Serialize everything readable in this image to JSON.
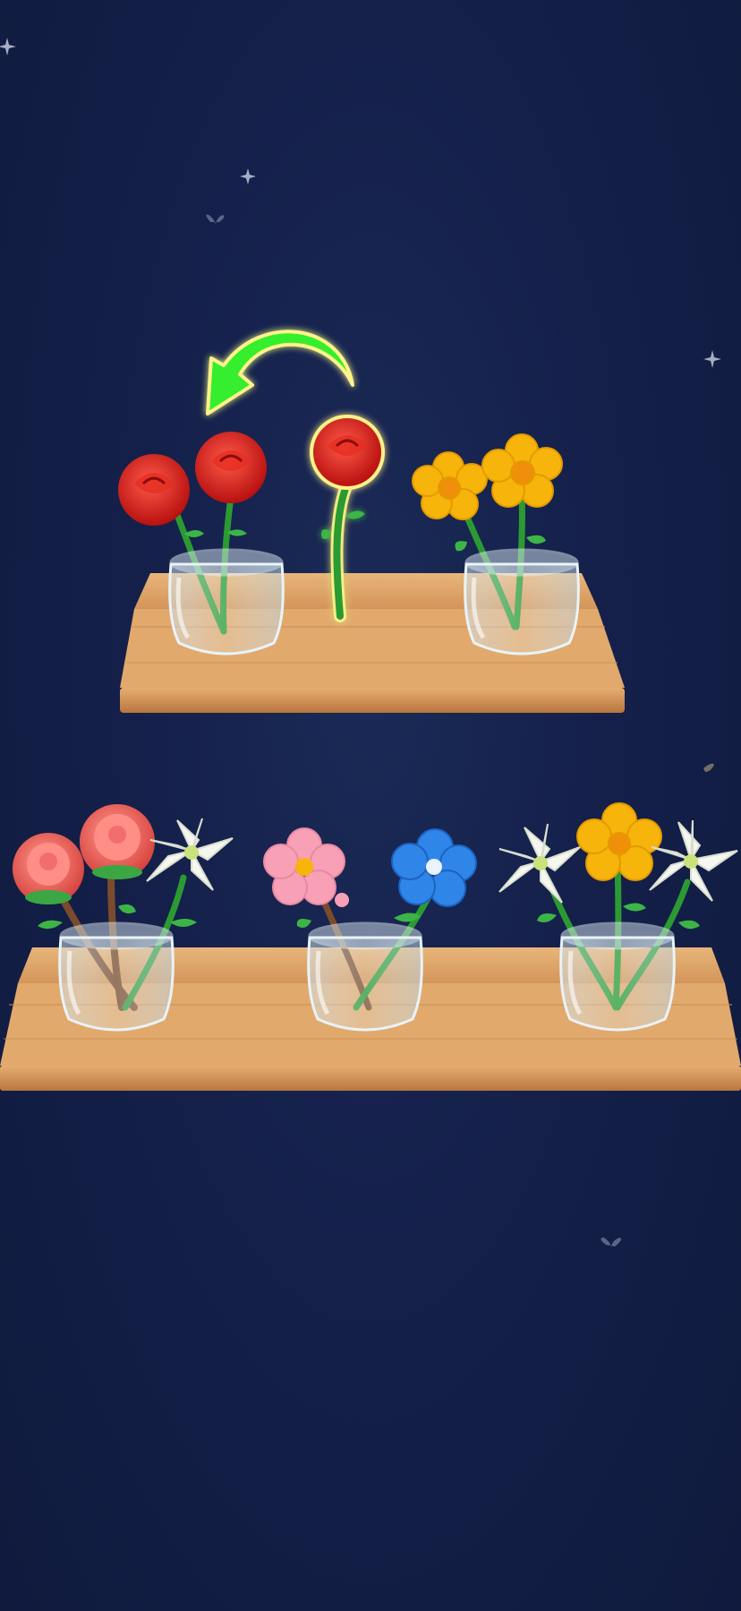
{
  "game": {
    "hint": {
      "arrow_direction": "left",
      "selected_flower": "red-rose"
    },
    "shelves": [
      {
        "vases": [
          {
            "flowers": [
              "red-rose",
              "red-rose"
            ]
          },
          {
            "flowers": [
              "yellow-buttercup",
              "yellow-buttercup"
            ]
          }
        ]
      },
      {
        "vases": [
          {
            "flowers": [
              "pink-peony",
              "pink-peony",
              "white-lily"
            ]
          },
          {
            "flowers": [
              "pink-blossom",
              "blue-flower"
            ]
          },
          {
            "flowers": [
              "white-lily",
              "yellow-buttercup",
              "white-lily"
            ]
          }
        ]
      }
    ]
  },
  "colors": {
    "background": "#14204a",
    "shelf_wood": "#d9a066",
    "hint_arrow": "#2ee82a",
    "rose": "#d91e1e",
    "buttercup": "#f7b40a",
    "peony": "#f26d6d",
    "lily": "#f6f7f0",
    "blossom": "#f7a0b6",
    "blue_flower": "#2f86e8"
  }
}
